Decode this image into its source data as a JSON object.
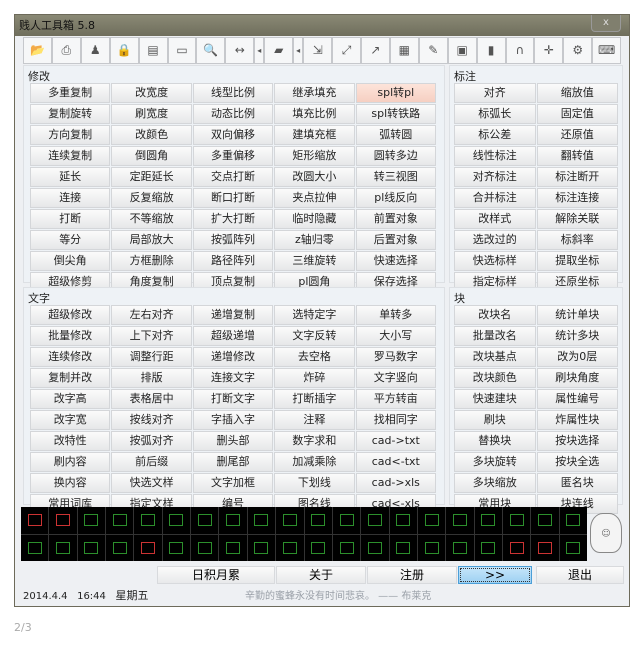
{
  "window": {
    "title": "贱人工具箱 5.8",
    "close": "x"
  },
  "toolbar": [
    "open-icon",
    "print-icon",
    "brush-icon",
    "lock-icon",
    "dwg-icon",
    "window-icon",
    "zoom-icon",
    "dimension-icon",
    "arrow-left-icon",
    "layer-icon",
    "arrow-left-icon",
    "move-icon",
    "scale-icon",
    "link-icon",
    "palette-icon",
    "edit-icon",
    "calculator-icon",
    "book-icon",
    "magnet-icon",
    "snap-icon",
    "gear-icon",
    "keyboard-icon"
  ],
  "modify": {
    "title": "修改",
    "buttons": [
      "多重复制",
      "改宽度",
      "线型比例",
      "继承填充",
      "spl转pl",
      "复制旋转",
      "刷宽度",
      "动态比例",
      "填充比例",
      "spl转铁路",
      "方向复制",
      "改颜色",
      "双向偏移",
      "建填充框",
      "弧转圆",
      "连续复制",
      "倒圆角",
      "多重偏移",
      "矩形缩放",
      "圆转多边",
      "延长",
      "定距延长",
      "交点打断",
      "改圆大小",
      "转三视图",
      "连接",
      "反复缩放",
      "断口打断",
      "夹点拉伸",
      "pl线反向",
      "打断",
      "不等缩放",
      "扩大打断",
      "临时隐藏",
      "前置对象",
      "等分",
      "局部放大",
      "按弧阵列",
      "z轴归零",
      "后置对象",
      "倒尖角",
      "方框删除",
      "路径阵列",
      "三维旋转",
      "快速选择",
      "超级修剪",
      "角度复制",
      "顶点复制",
      "pl圆角",
      "保存选择"
    ]
  },
  "dimension": {
    "title": "标注",
    "buttons": [
      "对齐",
      "缩放值",
      "标弧长",
      "固定值",
      "标公差",
      "还原值",
      "线性标注",
      "翻转值",
      "对齐标注",
      "标注断开",
      "合并标注",
      "标注连接",
      "改样式",
      "解除关联",
      "选改过的",
      "标斜率",
      "快选标样",
      "提取坐标",
      "指定标样",
      "还原坐标"
    ]
  },
  "text": {
    "title": "文字",
    "buttons": [
      "超级修改",
      "左右对齐",
      "递增复制",
      "选特定字",
      "单转多",
      "批量修改",
      "上下对齐",
      "超级递增",
      "文字反转",
      "大小写",
      "连续修改",
      "调整行距",
      "递增修改",
      "去空格",
      "罗马数字",
      "复制并改",
      "排版",
      "连接文字",
      "炸碎",
      "文字竖向",
      "改字高",
      "表格居中",
      "打断文字",
      "打断插字",
      "平方转亩",
      "改字宽",
      "按线对齐",
      "字插入字",
      "注释",
      "找相同字",
      "改特性",
      "按弧对齐",
      "删头部",
      "数字求和",
      "cad->txt",
      "刷内容",
      "前后缀",
      "删尾部",
      "加减乘除",
      "cad<-txt",
      "换内容",
      "快选文样",
      "文字加框",
      "下划线",
      "cad->xls",
      "常用词库",
      "指定文样",
      "编号",
      "图名线",
      "cad<-xls"
    ]
  },
  "block": {
    "title": "块",
    "buttons": [
      "改块名",
      "统计单块",
      "批量改名",
      "统计多块",
      "改块基点",
      "改为0层",
      "改块颜色",
      "刷块角度",
      "快速建块",
      "属性编号",
      "刷块",
      "炸属性块",
      "替换块",
      "按块选择",
      "多块旋转",
      "按块全选",
      "多块缩放",
      "匿名块",
      "常用块",
      "块连线"
    ]
  },
  "bottom": {
    "tips": "日积月累",
    "about": "关于",
    "register": "注册",
    "more": ">>",
    "exit": "退出"
  },
  "status": {
    "date": "2014.4.4",
    "time": "16:44",
    "weekday": "星期五",
    "quote": "辛勤的蜜蜂永没有时间悲哀。 —— 布莱克"
  },
  "pager": "2/3"
}
